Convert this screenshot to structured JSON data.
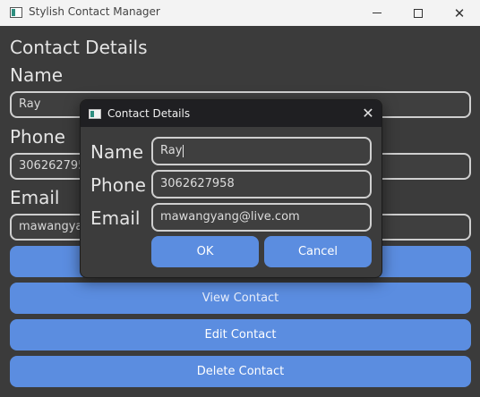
{
  "window": {
    "title": "Stylish Contact Manager"
  },
  "main": {
    "heading": "Contact Details",
    "name_label": "Name",
    "name_value": "Ray",
    "phone_label": "Phone",
    "phone_value": "3062627958",
    "email_label": "Email",
    "email_value": "mawangyang@live.com",
    "buttons": {
      "add": "",
      "view": "View Contact",
      "edit": "Edit Contact",
      "delete": "Delete Contact"
    }
  },
  "dialog": {
    "title": "Contact Details",
    "close_glyph": "✕",
    "name_label": "Name",
    "name_value": "Ray",
    "phone_label": "Phone",
    "phone_value": "3062627958",
    "email_label": "Email",
    "email_value": "mawangyang@live.com",
    "ok_label": "OK",
    "cancel_label": "Cancel"
  },
  "colors": {
    "accent": "#5b8de0",
    "background": "#3b3b3b",
    "dialog_titlebar": "#1f1f22"
  },
  "icons": {
    "app": "app-window-icon",
    "minimize": "minimize-icon",
    "maximize": "maximize-icon",
    "close": "close-icon"
  }
}
